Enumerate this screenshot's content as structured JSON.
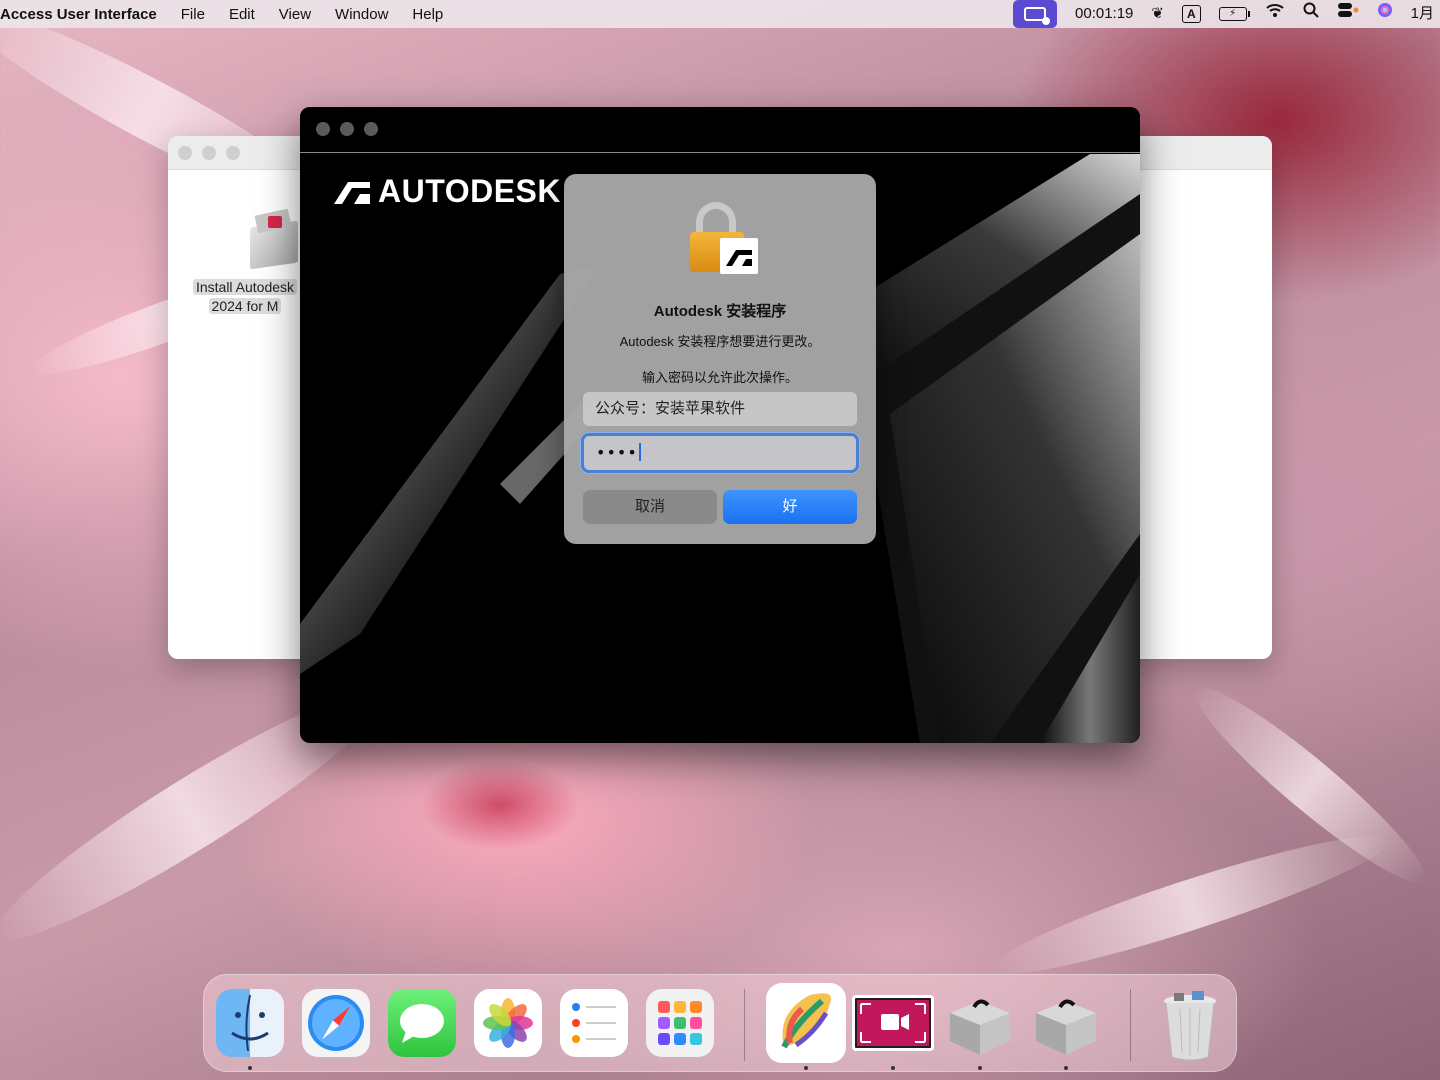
{
  "menubar": {
    "app_name": "Access User Interface",
    "menus": [
      "File",
      "Edit",
      "View",
      "Window",
      "Help"
    ],
    "clock": "00:01:19",
    "input_method": "A",
    "date": "1月"
  },
  "finder_window": {
    "file_label_line1": "Install Autodesk",
    "file_label_line2": "2024 for M"
  },
  "installer_window": {
    "logo_text": "AUTODESK"
  },
  "auth_dialog": {
    "title": "Autodesk 安装程序",
    "message": "Autodesk 安装程序想要进行更改。",
    "prompt": "输入密码以允许此次操作。",
    "username_value": "公众号：安装苹果软件",
    "password_masked": "••••",
    "cancel_label": "取消",
    "ok_label": "好"
  },
  "dock": {
    "items": [
      {
        "name": "finder",
        "running": true
      },
      {
        "name": "safari",
        "running": false
      },
      {
        "name": "messages",
        "running": false
      },
      {
        "name": "photos",
        "running": false
      },
      {
        "name": "reminders",
        "running": false
      },
      {
        "name": "launchpad",
        "running": false
      },
      {
        "name": "leaf-app",
        "running": true
      },
      {
        "name": "screen-recorder",
        "running": true
      },
      {
        "name": "autodesk-installer-1",
        "running": true
      },
      {
        "name": "autodesk-installer-2",
        "running": true
      },
      {
        "name": "trash",
        "running": false
      }
    ]
  }
}
